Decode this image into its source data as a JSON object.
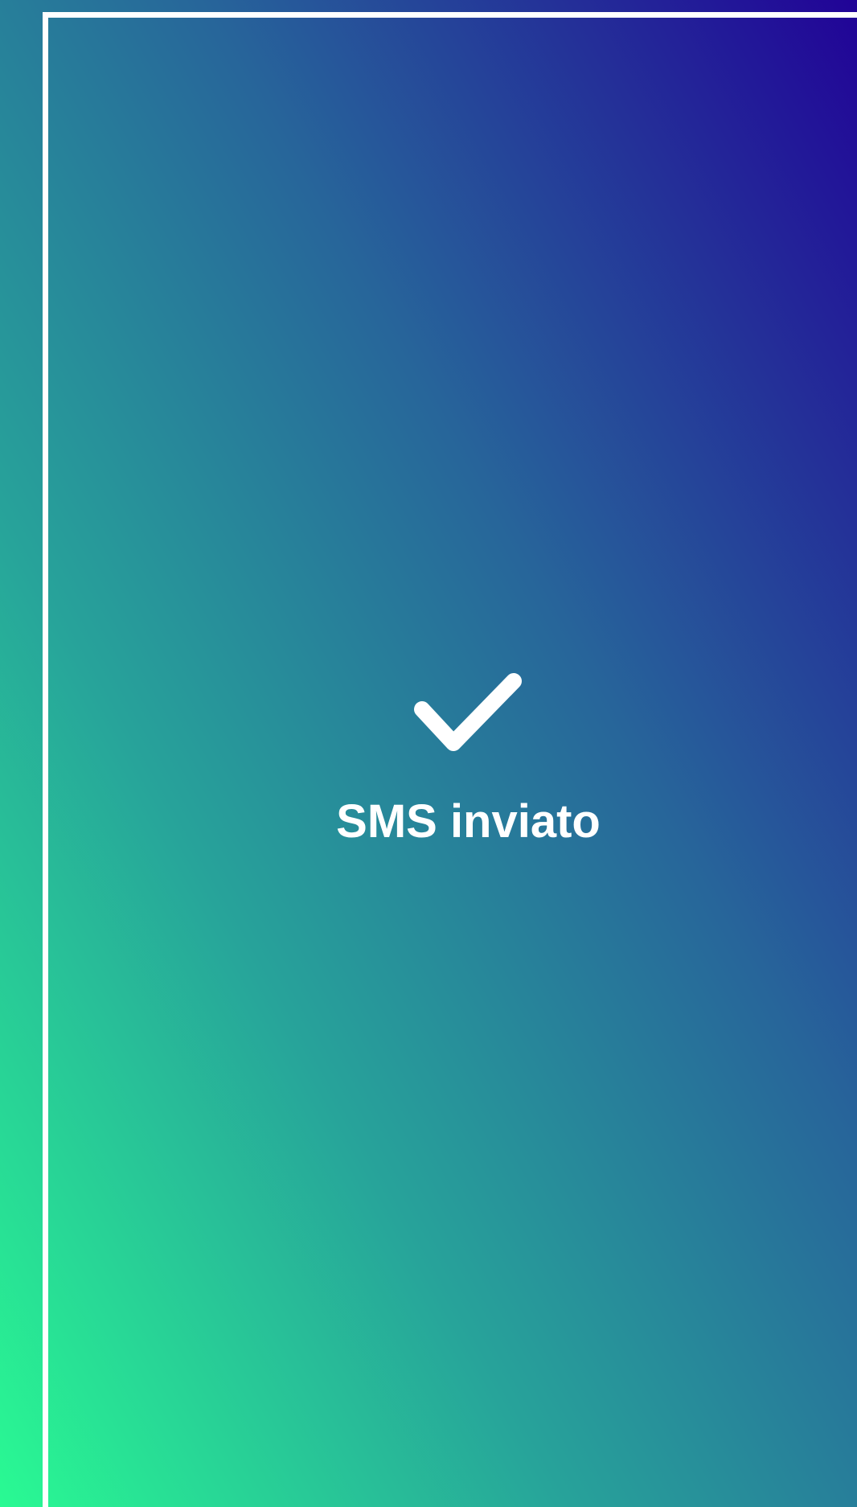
{
  "status": {
    "icon": "checkmark-icon",
    "message": "SMS inviato"
  },
  "theme": {
    "gradient_start": "#29fa93",
    "gradient_end": "#210397",
    "foreground": "#ffffff"
  }
}
